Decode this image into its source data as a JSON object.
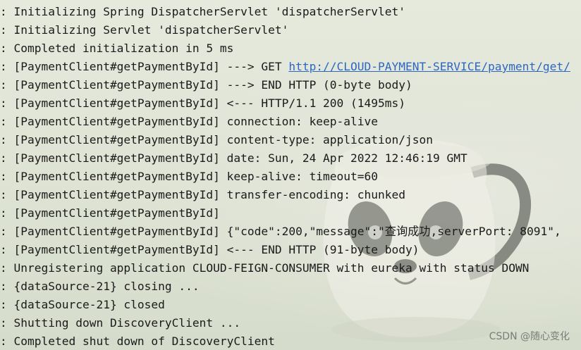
{
  "console": {
    "lines": [
      {
        "prefix": ": ",
        "text": "Initializing Spring DispatcherServlet 'dispatcherServlet'"
      },
      {
        "prefix": ": ",
        "text": "Initializing Servlet 'dispatcherServlet'"
      },
      {
        "prefix": ": ",
        "text": "Completed initialization in 5 ms"
      },
      {
        "prefix": ": ",
        "text": "[PaymentClient#getPaymentById] ---> GET ",
        "link": "http://CLOUD-PAYMENT-SERVICE/payment/get/"
      },
      {
        "prefix": ": ",
        "text": "[PaymentClient#getPaymentById] ---> END HTTP (0-byte body)"
      },
      {
        "prefix": ": ",
        "text": "[PaymentClient#getPaymentById] <--- HTTP/1.1 200 (1495ms)"
      },
      {
        "prefix": ": ",
        "text": "[PaymentClient#getPaymentById] connection: keep-alive"
      },
      {
        "prefix": ": ",
        "text": "[PaymentClient#getPaymentById] content-type: application/json"
      },
      {
        "prefix": ": ",
        "text": "[PaymentClient#getPaymentById] date: Sun, 24 Apr 2022 12:46:19 GMT"
      },
      {
        "prefix": ": ",
        "text": "[PaymentClient#getPaymentById] keep-alive: timeout=60"
      },
      {
        "prefix": ": ",
        "text": "[PaymentClient#getPaymentById] transfer-encoding: chunked"
      },
      {
        "prefix": ": ",
        "text": "[PaymentClient#getPaymentById]"
      },
      {
        "prefix": ": ",
        "text": "[PaymentClient#getPaymentById] {\"code\":200,\"message\":\"查询成功,serverPort: 8091\","
      },
      {
        "prefix": ": ",
        "text": "[PaymentClient#getPaymentById] <--- END HTTP (91-byte body)"
      },
      {
        "prefix": ": ",
        "text": "Unregistering application CLOUD-FEIGN-CONSUMER with eureka with status DOWN"
      },
      {
        "prefix": ": ",
        "text": "{dataSource-21} closing ..."
      },
      {
        "prefix": ": ",
        "text": "{dataSource-21} closed"
      },
      {
        "prefix": ": ",
        "text": "Shutting down DiscoveryClient ..."
      },
      {
        "prefix": ": ",
        "text": "Completed shut down of DiscoveryClient"
      }
    ]
  },
  "watermark": {
    "text": "CSDN @随心变化"
  },
  "background": {
    "image": "panda-mug-icon"
  },
  "colors": {
    "text": "#1a1a1a",
    "link": "#2d66c3",
    "background": "#dfe3d6"
  }
}
